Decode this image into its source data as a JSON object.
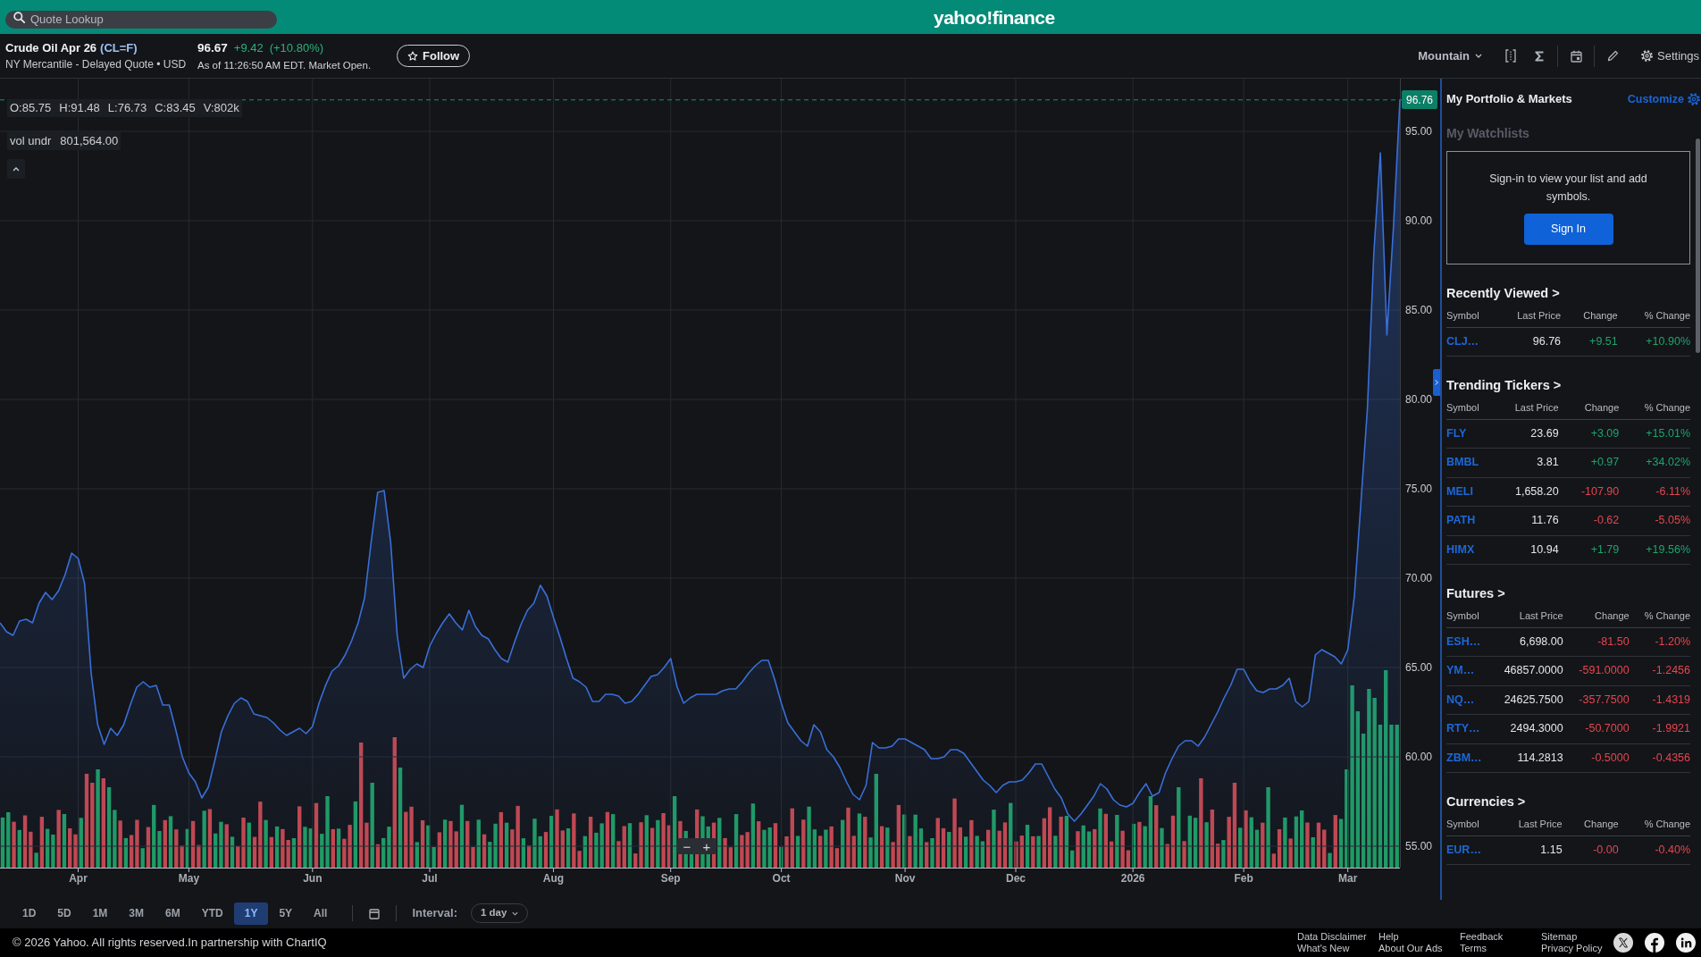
{
  "top_bar": {
    "search": {
      "placeholder": "Quote Lookup"
    },
    "logo": "yahoo!finance"
  },
  "quote_header": {
    "name": "Crude Oil Apr 26",
    "symbol": "(CL=F)",
    "exchange": "NY Mercantile - Delayed Quote • USD",
    "price": "96.67",
    "change": "+9.42",
    "change_percent": "(+10.80%)",
    "timestamp": "As of 11:26:50 AM EDT. Market Open.",
    "follow_button": "Follow"
  },
  "chart_toolbar": {
    "chart_type": "Mountain",
    "settings": "Settings"
  },
  "chart": {
    "ohlc": [
      "O:85.75",
      "H:91.48",
      "L:76.73",
      "C:83.45",
      "V:802k"
    ],
    "volume_label": "vol undr",
    "volume_value": "801,564.00",
    "zoom_controls": [
      "−",
      "+"
    ],
    "chart_data": {
      "type": "area",
      "grid": true,
      "ylim": [
        53.8,
        97.95
      ],
      "yticks": [
        {
          "value": 55,
          "label": "55.00"
        },
        {
          "value": 60,
          "label": "60.00"
        },
        {
          "value": 65,
          "label": "65.00"
        },
        {
          "value": 70,
          "label": "70.00"
        },
        {
          "value": 75,
          "label": "75.00"
        },
        {
          "value": 80,
          "label": "80.00"
        },
        {
          "value": 85,
          "label": "85.00"
        },
        {
          "value": 90,
          "label": "90.00"
        },
        {
          "value": 95,
          "label": "95.00"
        }
      ],
      "categories": [
        null,
        null,
        null,
        null,
        null,
        null,
        null,
        null,
        null,
        null,
        null,
        null,
        "Apr",
        null,
        null,
        null,
        null,
        null,
        null,
        null,
        null,
        null,
        null,
        null,
        null,
        null,
        null,
        null,
        null,
        "May",
        null,
        null,
        null,
        null,
        null,
        null,
        null,
        null,
        null,
        null,
        null,
        null,
        null,
        null,
        null,
        null,
        null,
        null,
        "Jun",
        null,
        null,
        null,
        null,
        null,
        null,
        null,
        null,
        null,
        null,
        null,
        null,
        null,
        null,
        null,
        null,
        null,
        "Jul",
        null,
        null,
        null,
        null,
        null,
        null,
        null,
        null,
        null,
        null,
        null,
        null,
        null,
        null,
        null,
        null,
        null,
        null,
        "Aug",
        null,
        null,
        null,
        null,
        null,
        null,
        null,
        null,
        null,
        null,
        null,
        null,
        null,
        null,
        null,
        null,
        null,
        "Sep",
        null,
        null,
        null,
        null,
        null,
        null,
        null,
        null,
        null,
        null,
        null,
        null,
        null,
        null,
        null,
        null,
        "Oct",
        null,
        null,
        null,
        null,
        null,
        null,
        null,
        null,
        null,
        null,
        null,
        null,
        null,
        null,
        null,
        null,
        null,
        null,
        "Nov",
        null,
        null,
        null,
        null,
        null,
        null,
        null,
        null,
        null,
        null,
        null,
        null,
        null,
        null,
        null,
        null,
        "Dec",
        null,
        null,
        null,
        null,
        null,
        null,
        null,
        null,
        null,
        null,
        null,
        null,
        null,
        null,
        null,
        null,
        null,
        "2026",
        null,
        null,
        null,
        null,
        null,
        null,
        null,
        null,
        null,
        null,
        null,
        null,
        null,
        null,
        null,
        null,
        "Feb",
        null,
        null,
        null,
        null,
        null,
        null,
        null,
        null,
        null,
        null,
        null,
        null,
        null,
        null,
        null,
        "Mar",
        null,
        null,
        null,
        null,
        null,
        null,
        null,
        null
      ],
      "series": [
        {
          "color": "#3a6fd8",
          "values": [
            67.5,
            67.0,
            66.8,
            67.6,
            67.7,
            67.5,
            68.6,
            69.2,
            68.8,
            69.3,
            70.2,
            71.4,
            71.1,
            69.7,
            64.7,
            61.8,
            60.7,
            61.6,
            61.2,
            61.8,
            62.9,
            63.9,
            64.2,
            63.9,
            64.0,
            62.9,
            62.9,
            61.5,
            60.0,
            59.1,
            58.6,
            57.7,
            58.3,
            59.8,
            61.4,
            62.3,
            63.0,
            63.3,
            63.1,
            62.4,
            62.3,
            62.2,
            61.9,
            61.5,
            61.2,
            61.4,
            61.6,
            61.3,
            61.7,
            63.0,
            64.0,
            64.8,
            65.1,
            65.7,
            66.5,
            67.5,
            68.9,
            72.0,
            74.8,
            74.9,
            72.0,
            66.8,
            64.4,
            64.9,
            65.2,
            65.0,
            66.2,
            66.9,
            67.5,
            68.0,
            67.5,
            67.1,
            68.2,
            67.3,
            66.8,
            66.6,
            66.0,
            65.5,
            65.3,
            66.4,
            67.4,
            68.2,
            68.6,
            69.6,
            69.0,
            67.8,
            66.7,
            65.5,
            64.4,
            64.2,
            63.9,
            63.1,
            63.1,
            63.5,
            63.5,
            63.4,
            63.0,
            63.1,
            63.5,
            64.0,
            64.5,
            64.6,
            65.0,
            65.5,
            63.9,
            63.0,
            63.3,
            63.5,
            63.5,
            63.5,
            63.5,
            63.7,
            63.8,
            63.8,
            64.2,
            64.7,
            65.1,
            65.4,
            65.4,
            64.3,
            63.0,
            61.9,
            61.4,
            60.9,
            60.6,
            61.8,
            61.4,
            60.4,
            60.0,
            59.4,
            58.6,
            57.9,
            57.6,
            58.4,
            60.8,
            60.5,
            60.5,
            60.6,
            61.0,
            61.0,
            60.8,
            60.6,
            60.4,
            59.9,
            59.9,
            60.0,
            60.4,
            60.4,
            60.2,
            59.7,
            59.2,
            58.7,
            58.4,
            58.0,
            58.4,
            58.6,
            58.6,
            58.7,
            59.1,
            59.6,
            59.6,
            58.9,
            58.2,
            57.7,
            56.8,
            56.4,
            56.8,
            57.3,
            57.8,
            58.5,
            58.2,
            57.6,
            57.3,
            57.2,
            57.4,
            58.0,
            58.5,
            57.8,
            58.0,
            59.1,
            59.9,
            60.6,
            60.9,
            60.9,
            60.6,
            61.1,
            61.8,
            62.5,
            63.3,
            64.0,
            64.9,
            64.9,
            64.2,
            63.7,
            63.6,
            63.8,
            63.8,
            64.0,
            64.4,
            63.1,
            62.8,
            63.1,
            65.7,
            66.0,
            65.8,
            65.6,
            65.2,
            66.0,
            69.0,
            74.2,
            79.5,
            88.2,
            93.8,
            83.6,
            89.6,
            96.76
          ]
        }
      ],
      "ref_lines": [
        {
          "axis": "y",
          "value": 96.76,
          "label": "96.76"
        }
      ]
    }
  },
  "range_toolbar": {
    "ranges": [
      {
        "label": "1D",
        "selected": false
      },
      {
        "label": "5D",
        "selected": false
      },
      {
        "label": "1M",
        "selected": false
      },
      {
        "label": "3M",
        "selected": false
      },
      {
        "label": "6M",
        "selected": false
      },
      {
        "label": "YTD",
        "selected": false
      },
      {
        "label": "1Y",
        "selected": true
      },
      {
        "label": "5Y",
        "selected": false
      },
      {
        "label": "All",
        "selected": false
      }
    ],
    "interval_label": "Interval:",
    "interval_value": "1 day"
  },
  "portfolio_panel": {
    "title": "My Portfolio & Markets",
    "customize": "Customize",
    "watchlists_title": "My Watchlists",
    "sign_in_prompt": "Sign-in to view your list and add symbols.",
    "sign_in_button": "Sign In",
    "sections": [
      {
        "title": "Recently Viewed >",
        "columns": [
          "Symbol",
          "Last Price",
          "Change",
          "% Change"
        ],
        "rows": [
          {
            "symbol": "CLJ…",
            "last_price": "96.76",
            "change": "+9.51",
            "percent_change": "+10.90%",
            "color": "#1ea46b"
          }
        ]
      },
      {
        "title": "Trending Tickers >",
        "columns": [
          "Symbol",
          "Last Price",
          "Change",
          "% Change"
        ],
        "rows": [
          {
            "symbol": "FLY",
            "last_price": "23.69",
            "change": "+3.09",
            "percent_change": "+15.01%",
            "color": "#1ea46b"
          },
          {
            "symbol": "BMBL",
            "last_price": "3.81",
            "change": "+0.97",
            "percent_change": "+34.02%",
            "color": "#1ea46b"
          },
          {
            "symbol": "MELI",
            "last_price": "1,658.20",
            "change": "-107.90",
            "percent_change": "-6.11%",
            "color": "#e4464f"
          },
          {
            "symbol": "PATH",
            "last_price": "11.76",
            "change": "-0.62",
            "percent_change": "-5.05%",
            "color": "#e4464f"
          },
          {
            "symbol": "HIMX",
            "last_price": "10.94",
            "change": "+1.79",
            "percent_change": "+19.56%",
            "color": "#1ea46b"
          }
        ]
      },
      {
        "title": "Futures >",
        "columns": [
          "Symbol",
          "Last Price",
          "Change",
          "% Change"
        ],
        "rows": [
          {
            "symbol": "ESH…",
            "last_price": "6,698.00",
            "change": "-81.50",
            "percent_change": "-1.20%",
            "color": "#e4464f"
          },
          {
            "symbol": "YM…",
            "last_price": "46857.0000",
            "change": "-591.0000",
            "percent_change": "-1.2456",
            "color": "#e4464f"
          },
          {
            "symbol": "NQ…",
            "last_price": "24625.7500",
            "change": "-357.7500",
            "percent_change": "-1.4319",
            "color": "#e4464f"
          },
          {
            "symbol": "RTY…",
            "last_price": "2494.3000",
            "change": "-50.7000",
            "percent_change": "-1.9921",
            "color": "#e4464f"
          },
          {
            "symbol": "ZBM…",
            "last_price": "114.2813",
            "change": "-0.5000",
            "percent_change": "-0.4356",
            "color": "#e4464f"
          }
        ]
      },
      {
        "title": "Currencies >",
        "columns": [
          "Symbol",
          "Last Price",
          "Change",
          "% Change"
        ],
        "rows": [
          {
            "symbol": "EUR…",
            "last_price": "1.15",
            "change": "-0.00",
            "percent_change": "-0.40%",
            "color": "#e4464f"
          }
        ]
      }
    ]
  },
  "footer": {
    "copyright": "© 2026 Yahoo. All rights reserved.In partnership with ChartIQ",
    "link_columns": [
      [
        "Data Disclaimer",
        "What's New"
      ],
      [
        "Help",
        "About Our Ads"
      ],
      [
        "Feedback",
        "Terms"
      ],
      [
        "Sitemap",
        "Privacy Policy"
      ]
    ]
  }
}
